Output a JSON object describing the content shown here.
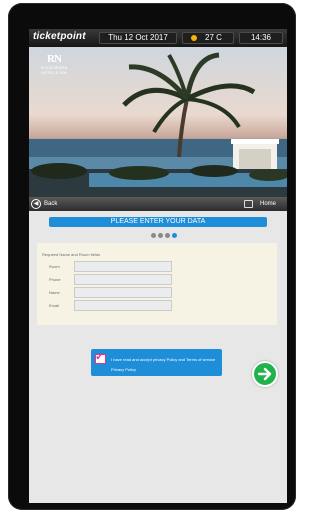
{
  "statusbar": {
    "logo": "ticketpoint",
    "date": "Thu 12 Oct 2017",
    "temperature": "27 C",
    "time": "14:36",
    "weather_icon": "sun-icon"
  },
  "hero": {
    "hotel_logo": "RN",
    "hotel_name": "ROCA NEGRA",
    "hotel_sub": "HOTEL & SPA"
  },
  "nav": {
    "back_label": "Back",
    "home_label": "Home"
  },
  "banner": {
    "title": "PLEASE ENTER YOUR DATA"
  },
  "steps": {
    "total": 4,
    "current": 4
  },
  "form": {
    "title": "Required Name and Room fields",
    "fields": [
      {
        "label": "Room",
        "value": ""
      },
      {
        "label": "Phone",
        "value": ""
      },
      {
        "label": "Name",
        "value": ""
      },
      {
        "label": "Email",
        "value": ""
      }
    ]
  },
  "privacy": {
    "text": "I have read and accept privacy Policy and Terms of service",
    "link": "Privacy Policy",
    "checked": true
  },
  "colors": {
    "accent": "#1f8ed9",
    "next": "#22b24c",
    "check": "#e23384"
  }
}
